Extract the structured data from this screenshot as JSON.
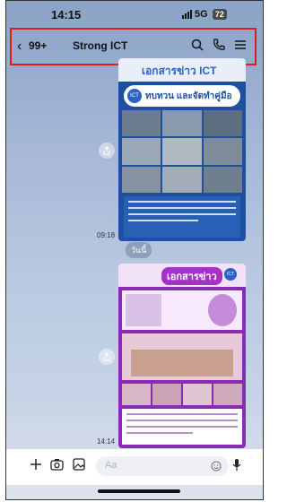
{
  "status": {
    "time": "14:15",
    "network": "5G",
    "battery": "72"
  },
  "header": {
    "back_count": "99+",
    "title": "Strong ICT",
    "icons": [
      "search-icon",
      "phone-icon",
      "menu-icon"
    ]
  },
  "messages": [
    {
      "poster": {
        "banner": "เอกสารข่าว ICT",
        "subtitle": "ทบทวน และจัดทำคู่มือ",
        "badge": "ICT"
      },
      "time": "09:18"
    },
    {
      "poster": {
        "banner": "เอกสารข่าว",
        "badge": "ICT"
      },
      "time": "14:14"
    }
  ],
  "day_separator": "วันนี้",
  "input": {
    "placeholder": "Aa"
  },
  "colors": {
    "highlight": "#e01b1b",
    "poster1": "#1f4fa0",
    "poster2": "#8a2bb5"
  }
}
